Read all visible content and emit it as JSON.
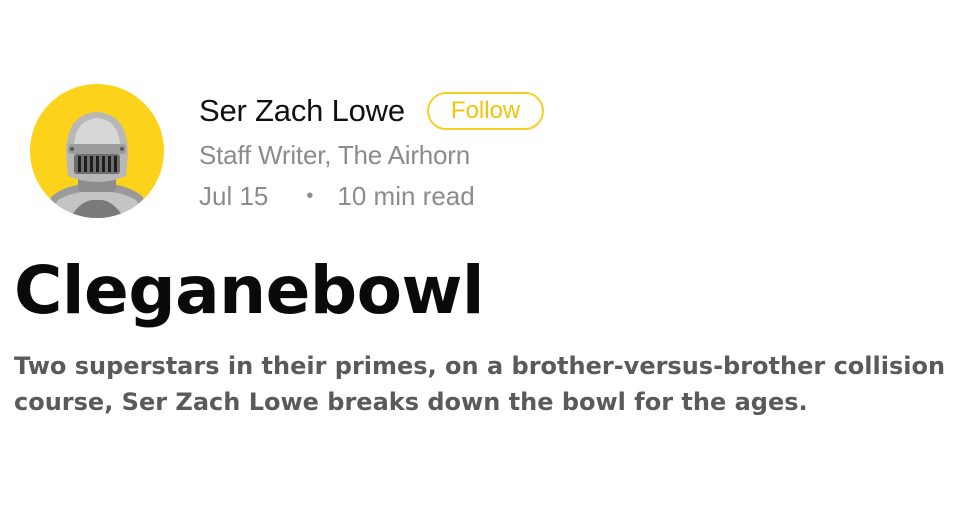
{
  "author": {
    "name": "Ser Zach Lowe",
    "role": "Staff Writer, The Airhorn",
    "avatar_icon": "knight-helmet-icon",
    "avatar_bg": "#fcd21b"
  },
  "follow": {
    "label": "Follow",
    "accent": "#f2c40b"
  },
  "meta": {
    "date": "Jul 15",
    "separator": "•",
    "read_time": "10 min read"
  },
  "article": {
    "title": "Cleganebowl",
    "subtitle": "Two superstars in their primes, on a brother-versus-brother collision course, Ser Zach Lowe breaks down the bowl for the ages."
  }
}
